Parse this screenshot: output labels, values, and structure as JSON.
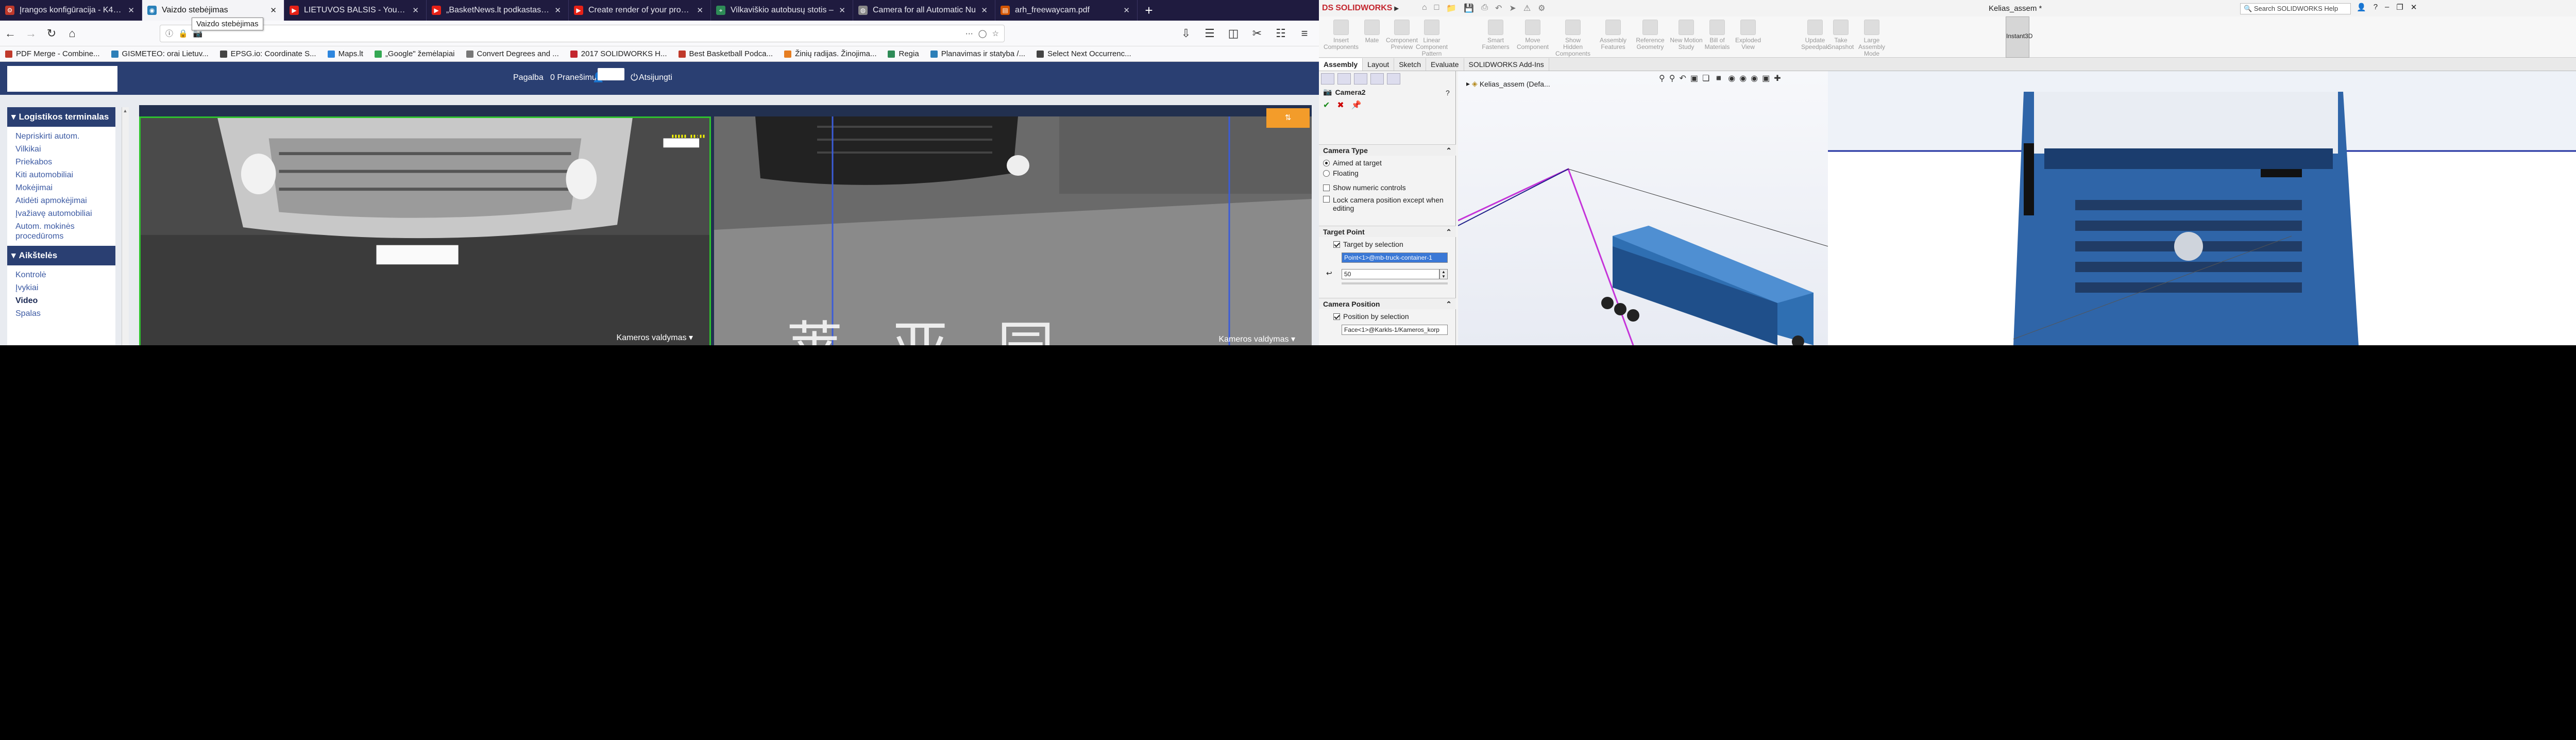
{
  "browser": {
    "tabs": [
      {
        "title": "Įrangos konfigūracija - K478 -",
        "favicon_color": "#c0392b",
        "favicon_icon": "gear-icon",
        "active": false
      },
      {
        "title": "Vaizdo stebėjimas",
        "favicon_color": "#2980b9",
        "favicon_icon": "camera-icon",
        "active": true
      },
      {
        "title": "LIETUVOS BALSIS - YouTube",
        "favicon_color": "#e62117",
        "favicon_icon": "play-icon",
        "active": false
      },
      {
        "title": "„BasketNews.lt podkastas\": ar",
        "favicon_color": "#e62117",
        "favicon_icon": "play-icon",
        "active": false
      },
      {
        "title": "Create render of your product",
        "favicon_color": "#e62117",
        "favicon_icon": "play-icon",
        "active": false
      },
      {
        "title": "Vilkaviškio autobusų stotis –",
        "favicon_color": "#2e8b57",
        "favicon_icon": "map-icon",
        "active": false
      },
      {
        "title": "Camera for all Automatic Nu",
        "favicon_color": "#888888",
        "favicon_icon": "globe-icon",
        "active": false
      },
      {
        "title": "arh_freewaycam.pdf",
        "favicon_color": "#d35400",
        "favicon_icon": "pdf-icon",
        "active": false
      }
    ],
    "tab_tooltip": "Vaizdo stebėjimas",
    "bookmarks": [
      {
        "label": "PDF Merge - Combine...",
        "color": "#c0392b"
      },
      {
        "label": "GISMETEO: orai Lietuv...",
        "color": "#2c7fb8"
      },
      {
        "label": "EPSG.io: Coordinate S...",
        "color": "#444444"
      },
      {
        "label": "Maps.lt",
        "color": "#2e86de"
      },
      {
        "label": "„Google\" žemėlapiai",
        "color": "#34a853"
      },
      {
        "label": "Convert Degrees and ...",
        "color": "#777777"
      },
      {
        "label": "2017 SOLIDWORKS H...",
        "color": "#c3262e"
      },
      {
        "label": "Best Basketball Podca...",
        "color": "#c0392b"
      },
      {
        "label": "Žinių radijas. Žinojima...",
        "color": "#e67e22"
      },
      {
        "label": "Regia",
        "color": "#2e8b57"
      },
      {
        "label": "Planavimas ir statyba /...",
        "color": "#2c7fb8"
      },
      {
        "label": "Select Next Occurrenc...",
        "color": "#444444"
      }
    ]
  },
  "site": {
    "header": {
      "help": "Pagalba",
      "notices": "0 Pranešimų",
      "logout": "Atsijungti"
    },
    "sidebar": {
      "section1_title": "Logistikos terminalas",
      "section1_items": [
        "Nepriskirti autom.",
        "Vilkikai",
        "Priekabos",
        "Kiti automobiliai",
        "Mokėjimai",
        "Atidėti apmokėjimai",
        "Įvažiavę automobiliai",
        "Autom. mokinės procedūroms"
      ],
      "section2_title": "Aikštelės",
      "section2_items": [
        "Kontrolė",
        "Įvykiai",
        "Video",
        "Spalas"
      ],
      "current_item": "Video"
    },
    "cameras": [
      {
        "label": "Kameros valdymas"
      },
      {
        "label": "Kameros valdymas"
      }
    ],
    "watermark": "莱 亚 园"
  },
  "solidworks": {
    "app_name": "SOLIDWORKS",
    "doc_title": "Kelias_assem *",
    "search_placeholder": "Search SOLIDWORKS Help",
    "ribbon": [
      "Insert Components",
      "Mate",
      "Component Preview",
      "Linear Component Pattern",
      "Smart Fasteners",
      "Move Component",
      "Show Hidden Components",
      "Assembly Features",
      "Reference Geometry",
      "New Motion Study",
      "Bill of Materials",
      "Exploded View",
      "Instant3D",
      "Update Speedpak",
      "Take Snapshot",
      "Large Assembly Mode"
    ],
    "tabs": [
      "Assembly",
      "Layout",
      "Sketch",
      "Evaluate",
      "SOLIDWORKS Add-Ins"
    ],
    "active_tab": "Assembly",
    "property_manager": {
      "title": "Camera2",
      "camera_type_head": "Camera Type",
      "aimed_at_target": "Aimed at target",
      "floating": "Floating",
      "show_numeric": "Show numeric controls",
      "lock_position": "Lock camera position except when editing",
      "target_point_head": "Target Point",
      "target_by_selection": "Target by selection",
      "target_value": "Point<1>@mb-truck-container-1",
      "spin_value": "50",
      "camera_position_head": "Camera Position",
      "position_by_selection": "Position by selection",
      "position_value": "Face<1>@Karkls-1/Kameros_korp"
    },
    "tree_root": "Kelias_assem (Defa..."
  }
}
